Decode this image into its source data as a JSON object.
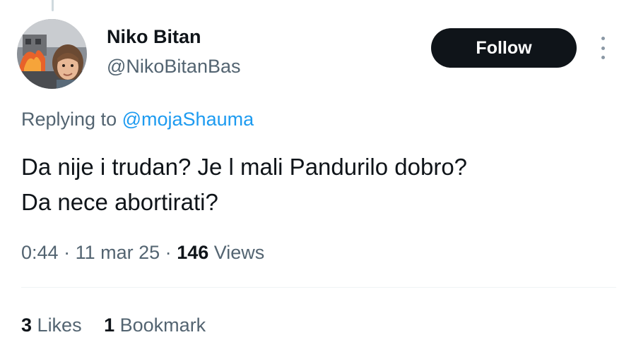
{
  "tweet": {
    "author": {
      "display_name": "Niko Bitan",
      "handle": "@NikoBitanBas"
    },
    "follow_label": "Follow",
    "replying_prefix": "Replying to",
    "replying_to": "@mojaShauma",
    "text_line1": "Da nije i trudan? Je l mali Pandurilo dobro?",
    "text_line2": "Da nece abortirati?",
    "time": "0:44",
    "separator": "·",
    "date": "11 mar 25",
    "views_count": "146",
    "views_label": "Views",
    "likes_count": "3",
    "likes_label": "Likes",
    "bookmarks_count": "1",
    "bookmarks_label": "Bookmark"
  },
  "icons": {
    "avatar": "avatar-image",
    "more": "more-icon"
  },
  "colors": {
    "text_primary": "#0f1419",
    "text_secondary": "#536471",
    "link": "#1d9bf0",
    "follow_bg": "#0f1419",
    "divider": "#eff3f4"
  }
}
